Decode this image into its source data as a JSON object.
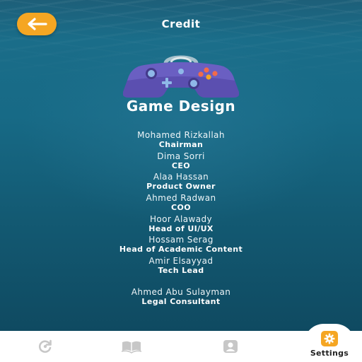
{
  "header": {
    "title": "Credit",
    "back_icon": "arrow-left-icon"
  },
  "section": {
    "title": "Game Design",
    "icon": "gamepad-icon"
  },
  "credits": [
    {
      "name": "Mohamed Rizkallah",
      "role": "Chairman"
    },
    {
      "name": "Dima Sorri",
      "role": "CEO"
    },
    {
      "name": "Alaa Hassan",
      "role": "Product Owner"
    },
    {
      "name": "Ahmed Radwan",
      "role": "COO"
    },
    {
      "name": "Hoor Alawady",
      "role": "Head of UI/UX"
    },
    {
      "name": "Hossam Serag",
      "role": "Head of Academic Content"
    },
    {
      "name": "Amir Elsayyad",
      "role": "Tech Lead"
    },
    {
      "name": "Ahmed Abu Sulayman",
      "role": "Legal Consultant"
    }
  ],
  "tabbar": {
    "tabs": [
      {
        "icon": "refresh-icon"
      },
      {
        "icon": "book-icon"
      },
      {
        "icon": "profile-icon"
      },
      {
        "icon": "gear-icon",
        "label": "Settings",
        "active": true
      }
    ]
  },
  "colors": {
    "accent": "#f5a623",
    "background": "#176a86",
    "controller": "#5b4fb0"
  }
}
